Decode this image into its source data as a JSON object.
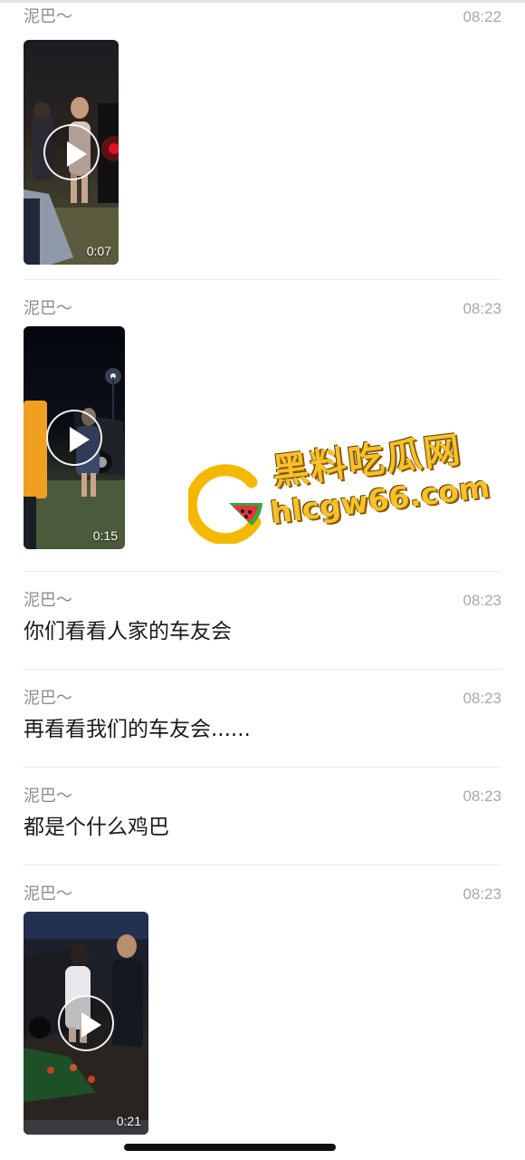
{
  "messages": [
    {
      "sender": "泥巴～",
      "time": "08:22",
      "type": "video",
      "duration": "0:07"
    },
    {
      "sender": "泥巴～",
      "time": "08:23",
      "type": "video",
      "duration": "0:15"
    },
    {
      "sender": "泥巴～",
      "time": "08:23",
      "type": "text",
      "text": "你们看看人家的车友会"
    },
    {
      "sender": "泥巴～",
      "time": "08:23",
      "type": "text",
      "text": "再看看我们的车友会......"
    },
    {
      "sender": "泥巴～",
      "time": "08:23",
      "type": "text",
      "text": "都是个什么鸡巴"
    },
    {
      "sender": "泥巴～",
      "time": "08:23",
      "type": "video",
      "duration": "0:21"
    }
  ],
  "watermark": {
    "title": "黑料吃瓜网",
    "url": "hlcgw66.com"
  },
  "icons": {
    "play": "play-icon",
    "logo": "watermark-logo-icon"
  },
  "colors": {
    "watermark": "#f7c12b",
    "text": "#1a1a1a",
    "meta": "#a8a8a8"
  }
}
